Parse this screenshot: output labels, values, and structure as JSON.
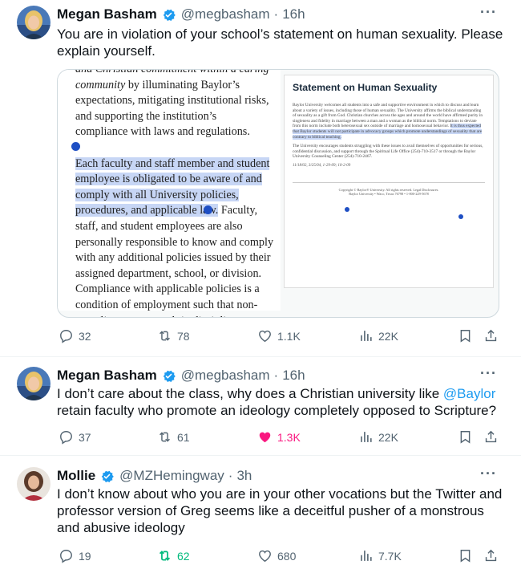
{
  "tweets": [
    {
      "name": "Megan Basham",
      "handle": "@megbasham",
      "time": "16h",
      "text": "You are in violation of your school’s statement on human sexuality. Please explain yourself.",
      "media": {
        "left_lines": [
          {
            "text": "and Christian commitment within a caring",
            "selected": false,
            "italic": true
          },
          {
            "text": "community by illuminating Baylor’s",
            "selected": false,
            "italic_prefix": "community"
          },
          {
            "text": "expectations, mitigating institutional risks,",
            "selected": false
          },
          {
            "text": "and supporting the institution’s",
            "selected": false
          },
          {
            "text": "compliance with laws and regulations.",
            "selected": false
          },
          {
            "text": "",
            "selected": false
          },
          {
            "text": "Each faculty and staff member and student",
            "selected": true
          },
          {
            "text": "employee is obligated to be aware of and",
            "selected": true
          },
          {
            "text": "comply with all University policies,",
            "selected": true
          },
          {
            "text": "procedures, and applicable law.",
            "selected": true,
            "tail": " Faculty,"
          },
          {
            "text": "staff, and student employees are also",
            "selected": false
          },
          {
            "text": "personally responsible to know and comply",
            "selected": false
          },
          {
            "text": "with any additional policies issued by their",
            "selected": false
          },
          {
            "text": "assigned department, school, or division.",
            "selected": false
          },
          {
            "text": "Compliance with applicable policies is a",
            "selected": false
          },
          {
            "text": "condition of employment such that non-",
            "selected": false
          },
          {
            "text": "compliance may result in discipline, up to",
            "selected": false
          }
        ],
        "right_title": "Statement on Human Sexuality",
        "right_p1": "Baylor University welcomes all students into a safe and supportive environment in which to discuss and learn about a variety of issues, including those of human sexuality. The University affirms the biblical understanding of sexuality as a gift from God. Christian churches across the ages and around the world have affirmed purity in singleness and fidelity in marriage between a man and a woman as the biblical norm. Temptations to deviate from this norm include both heterosexual sex outside of marriage and homosexual behavior.",
        "right_p1_highlight": "It is thus expected that Baylor students will not participate in advocacy groups which promote understandings of sexuality that are contrary to biblical teaching.",
        "right_p2": "The University encourages students struggling with these issues to avail themselves of opportunities for serious, confidential discussion, and support through the Spiritual Life Office (254)-710-3517 or through the Baylor University Counseling Center (254)-710-2467.",
        "right_date": "11/18/02, 3/25/04, 1-29-09; 10-2-09",
        "right_footer_1": "Copyright © Baylor® University. All rights reserved. Legal Disclosures.",
        "right_footer_2": "Baylor University • Waco, Texas 76798 • 1-800-229-5678"
      },
      "replies": "32",
      "retweets": "78",
      "likes": "1.1K",
      "views": "22K"
    },
    {
      "name": "Megan Basham",
      "handle": "@megbasham",
      "time": "16h",
      "text_before": "I don’t care about the class, why does a Christian university like ",
      "mention": "@Baylor",
      "text_after": " retain faculty who promote an ideology completely opposed to Scripture?",
      "replies": "37",
      "retweets": "61",
      "likes": "1.3K",
      "views": "22K"
    },
    {
      "name": "Mollie",
      "handle": "@MZHemingway",
      "time": "3h",
      "text": "I don’t know about who you are in your other vocations but the Twitter and professor version of Greg seems like a deceitful pusher of a monstrous and abusive ideology",
      "replies": "19",
      "retweets": "62",
      "likes": "680",
      "views": "7.7K"
    }
  ],
  "more_label": "···",
  "colors": {
    "accent": "#1d9bf0",
    "like": "#f91880",
    "retweet": "#00ba7c",
    "muted": "#536471"
  }
}
